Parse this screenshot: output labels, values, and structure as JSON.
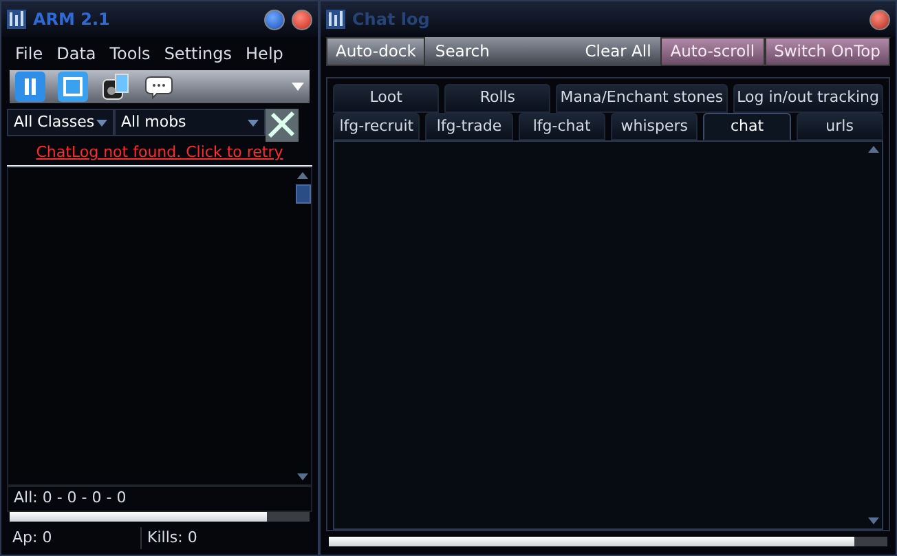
{
  "main_window": {
    "title": "ARM 2.1",
    "menu": [
      "File",
      "Data",
      "Tools",
      "Settings",
      "Help"
    ],
    "toolbar": [
      {
        "kind": "pause"
      },
      {
        "kind": "stop"
      },
      {
        "kind": "device"
      },
      {
        "kind": "chat"
      }
    ],
    "filters": [
      {
        "value": "All Classes"
      },
      {
        "value": "All mobs"
      }
    ],
    "link": "ChatLog not found. Click to retry",
    "summary": "All: 0 - 0 - 0 - 0",
    "progress": {
      "level": 0.86
    },
    "status_bar": [
      "Ap: 0",
      "Kills: 0"
    ]
  },
  "chat_window": {
    "title": "Chat log",
    "buttons": [
      {
        "label": "Auto-dock",
        "on": false
      },
      {
        "label": "Search",
        "on": false
      },
      {
        "label": "Clear All",
        "on": false
      },
      {
        "label": "Auto-scroll",
        "on": true
      },
      {
        "label": "Switch OnTop",
        "on": true
      }
    ],
    "tab_rows": [
      [
        {
          "label": "Loot",
          "selected": false
        },
        {
          "label": "Rolls",
          "selected": false
        },
        {
          "label": "Mana/Enchant stones",
          "selected": false
        },
        {
          "label": "Log in/out tracking",
          "selected": false
        }
      ],
      [
        {
          "label": "lfg-recruit",
          "selected": false
        },
        {
          "label": "lfg-trade",
          "selected": false
        },
        {
          "label": "lfg-chat",
          "selected": false
        },
        {
          "label": "whispers",
          "selected": false
        },
        {
          "label": "chat",
          "selected": true
        },
        {
          "label": "urls",
          "selected": false
        }
      ]
    ],
    "progress": {
      "level": 0.94
    }
  }
}
